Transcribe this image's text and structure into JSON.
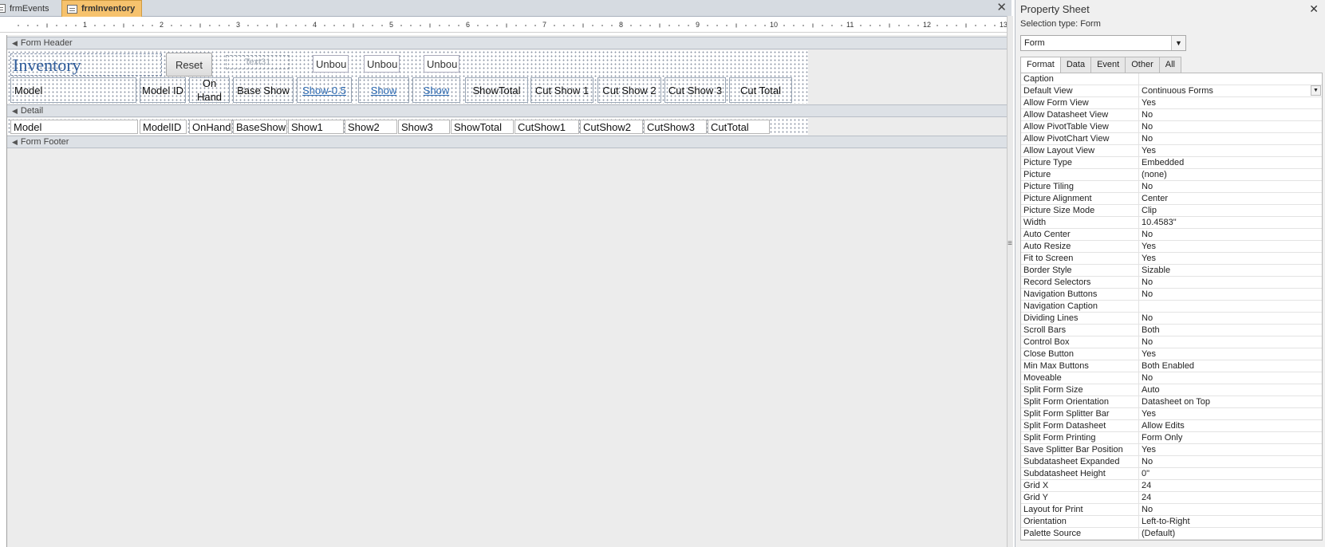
{
  "tabs": [
    {
      "label": "frmEvents",
      "active": false
    },
    {
      "label": "frmInventory",
      "active": true
    }
  ],
  "ruler": {
    "numbers": [
      "1",
      "2",
      "3",
      "4",
      "5",
      "6",
      "7",
      "8",
      "9",
      "10",
      "11",
      "12",
      "13"
    ]
  },
  "form": {
    "sections": {
      "header": "Form Header",
      "detail": "Detail",
      "footer": "Form Footer"
    },
    "header": {
      "title": "Inventory",
      "reset_label": "Reset",
      "ghost_label": "Text31",
      "unbound": [
        "Unbou",
        "Unbou",
        "Unbou"
      ],
      "labels": [
        "Model",
        "Model ID",
        "On Hand",
        "Base Show",
        "Show-0.5",
        "Show",
        "Show",
        "ShowTotal",
        "Cut Show 1",
        "Cut Show 2",
        "Cut Show 3",
        "Cut Total"
      ]
    },
    "detail_fields": [
      "Model",
      "ModelID",
      "OnHand",
      "BaseShow",
      "Show1",
      "Show2",
      "Show3",
      "ShowTotal",
      "CutShow1",
      "CutShow2",
      "CutShow3",
      "CutTotal"
    ]
  },
  "property_sheet": {
    "title": "Property Sheet",
    "selection_type": "Selection type:  Form",
    "selected_object": "Form",
    "tabs": [
      "Format",
      "Data",
      "Event",
      "Other",
      "All"
    ],
    "active_tab": "Format",
    "properties": [
      {
        "name": "Caption",
        "value": ""
      },
      {
        "name": "Default View",
        "value": "Continuous Forms"
      },
      {
        "name": "Allow Form View",
        "value": "Yes"
      },
      {
        "name": "Allow Datasheet View",
        "value": "No"
      },
      {
        "name": "Allow PivotTable View",
        "value": "No"
      },
      {
        "name": "Allow PivotChart View",
        "value": "No"
      },
      {
        "name": "Allow Layout View",
        "value": "Yes"
      },
      {
        "name": "Picture Type",
        "value": "Embedded"
      },
      {
        "name": "Picture",
        "value": "(none)"
      },
      {
        "name": "Picture Tiling",
        "value": "No"
      },
      {
        "name": "Picture Alignment",
        "value": "Center"
      },
      {
        "name": "Picture Size Mode",
        "value": "Clip"
      },
      {
        "name": "Width",
        "value": "10.4583\""
      },
      {
        "name": "Auto Center",
        "value": "No"
      },
      {
        "name": "Auto Resize",
        "value": "Yes"
      },
      {
        "name": "Fit to Screen",
        "value": "Yes"
      },
      {
        "name": "Border Style",
        "value": "Sizable"
      },
      {
        "name": "Record Selectors",
        "value": "No"
      },
      {
        "name": "Navigation Buttons",
        "value": "No"
      },
      {
        "name": "Navigation Caption",
        "value": ""
      },
      {
        "name": "Dividing Lines",
        "value": "No"
      },
      {
        "name": "Scroll Bars",
        "value": "Both"
      },
      {
        "name": "Control Box",
        "value": "No"
      },
      {
        "name": "Close Button",
        "value": "Yes"
      },
      {
        "name": "Min Max Buttons",
        "value": "Both Enabled"
      },
      {
        "name": "Moveable",
        "value": "No"
      },
      {
        "name": "Split Form Size",
        "value": "Auto"
      },
      {
        "name": "Split Form Orientation",
        "value": "Datasheet on Top"
      },
      {
        "name": "Split Form Splitter Bar",
        "value": "Yes"
      },
      {
        "name": "Split Form Datasheet",
        "value": "Allow Edits"
      },
      {
        "name": "Split Form Printing",
        "value": "Form Only"
      },
      {
        "name": "Save Splitter Bar Position",
        "value": "Yes"
      },
      {
        "name": "Subdatasheet Expanded",
        "value": "No"
      },
      {
        "name": "Subdatasheet Height",
        "value": "0\""
      },
      {
        "name": "Grid X",
        "value": "24"
      },
      {
        "name": "Grid Y",
        "value": "24"
      },
      {
        "name": "Layout for Print",
        "value": "No"
      },
      {
        "name": "Orientation",
        "value": "Left-to-Right"
      },
      {
        "name": "Palette Source",
        "value": "(Default)"
      }
    ]
  }
}
